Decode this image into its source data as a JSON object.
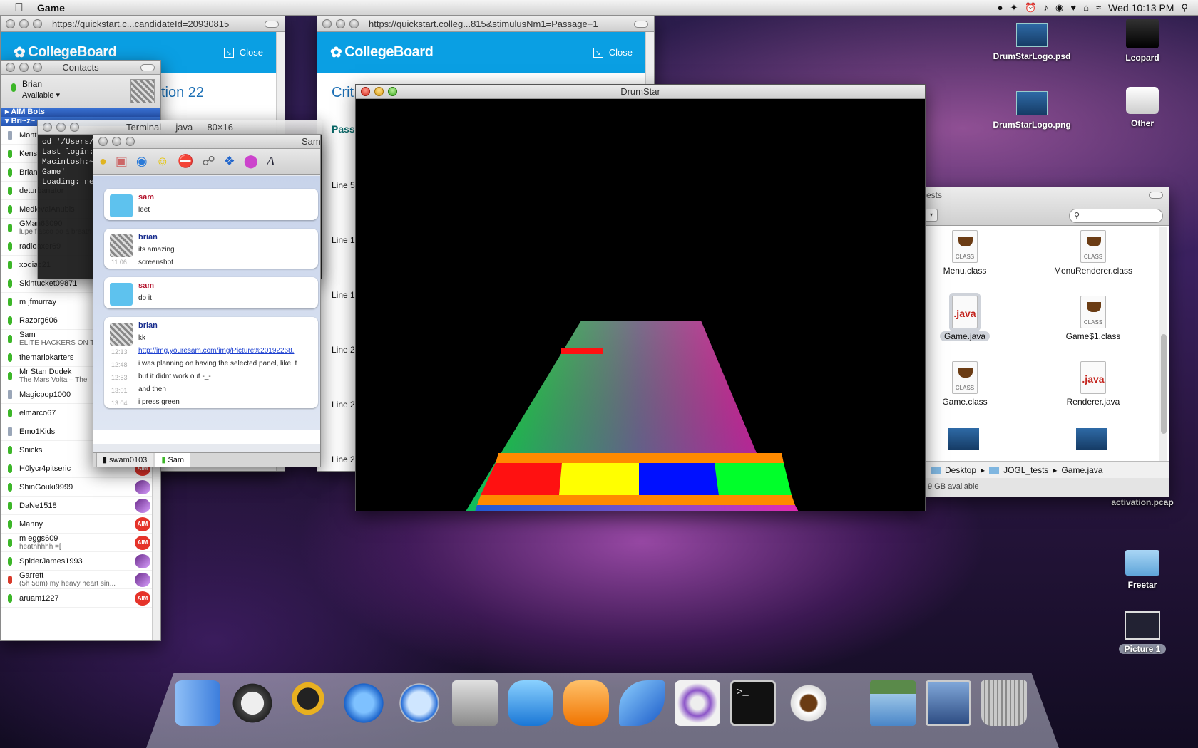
{
  "menubar": {
    "app_name": "Game",
    "clock": "Wed 10:13 PM"
  },
  "cb_window1": {
    "url": "https://quickstart.c...candidateId=20930815",
    "logo": "CollegeBoard",
    "close_label": "Close",
    "heading_fragment": "tion 22"
  },
  "cb_window2": {
    "url": "https://quickstart.colleg...815&stimulusNm1=Passage+1",
    "logo": "CollegeBoard",
    "close_label": "Close",
    "heading_fragment": "Crit",
    "subheading_fragment": "Pass",
    "lines": [
      "Line 5",
      "Line 1",
      "Line 1",
      "Line 2",
      "Line 2",
      "Line 2"
    ]
  },
  "contacts": {
    "title": "Contacts",
    "user_name": "Brian",
    "status": "Available",
    "group1": "AIM Bots",
    "group2": "Bri~z~",
    "items": [
      {
        "name": "Mont",
        "sub": "",
        "badge": ""
      },
      {
        "name": "Kens",
        "sub": "",
        "badge": ""
      },
      {
        "name": "Brian",
        "sub": "",
        "badge": ""
      },
      {
        "name": "deturbanator",
        "sub": "",
        "badge": ""
      },
      {
        "name": "MedievalAnubis",
        "sub": "",
        "badge": ""
      },
      {
        "name": "GMan63090",
        "sub": "lupe fiasco oo a breath",
        "badge": ""
      },
      {
        "name": "radioaxer69",
        "sub": "",
        "badge": ""
      },
      {
        "name": "xodiac21",
        "sub": "",
        "badge": ""
      },
      {
        "name": "Skintucket09871",
        "sub": "",
        "badge": ""
      },
      {
        "name": "m    jfmurray",
        "sub": "",
        "badge": ""
      },
      {
        "name": "Razorg606",
        "sub": "",
        "badge": ""
      },
      {
        "name": "Sam",
        "sub": "ELITE HACKERS ON TH",
        "badge": ""
      },
      {
        "name": "themariokarters",
        "sub": "",
        "badge": ""
      },
      {
        "name": "Mr Stan Dudek",
        "sub": "The Mars Volta – The",
        "badge": ""
      },
      {
        "name": "Magicpop1000",
        "sub": "",
        "badge": ""
      },
      {
        "name": "elmarco67",
        "sub": "",
        "badge": ""
      },
      {
        "name": "Emo1Kids",
        "sub": "",
        "badge": ""
      },
      {
        "name": "Snicks",
        "sub": "",
        "badge": "AIM"
      },
      {
        "name": "H0lycr4pitseric",
        "sub": "",
        "badge": "AIM"
      },
      {
        "name": "ShinGouki9999",
        "sub": "",
        "badge": "img"
      },
      {
        "name": "DaNe1518",
        "sub": "",
        "badge": "img"
      },
      {
        "name": "Manny",
        "sub": "",
        "badge": "AIM"
      },
      {
        "name": "m eggs609",
        "sub": "heathhhhh =[",
        "badge": "AIM"
      },
      {
        "name": "SpiderJames1993",
        "sub": "",
        "badge": "img"
      },
      {
        "name": "Garrett",
        "sub": "(5h 58m) my heavy heart sin...",
        "badge": "img"
      },
      {
        "name": "aruam1227",
        "sub": "",
        "badge": "AIM"
      }
    ]
  },
  "terminal": {
    "title": "Terminal — java — 80×16",
    "lines": [
      "cd '/Users/h",
      "Last login:",
      "Macintosh:~",
      "Game'",
      "Loading: net"
    ]
  },
  "chat": {
    "title": "Sam",
    "messages": [
      {
        "sender": "sam",
        "lines": [
          "leet"
        ],
        "times": []
      },
      {
        "sender": "brian",
        "lines": [
          "its amazing",
          "screenshot"
        ],
        "times": [
          "",
          "11:06"
        ]
      },
      {
        "sender": "sam",
        "lines": [
          "do it"
        ],
        "times": []
      },
      {
        "sender": "brian",
        "lines": [
          "kk",
          "http://img.youresam.com/img/Picture%20192268.",
          "i was planning on having the selected panel, like, t",
          "but it didnt work out -_-",
          "and then",
          "i press green"
        ],
        "times": [
          "",
          "12:13",
          "12:48",
          "12:53",
          "13:01",
          "13:04"
        ]
      }
    ],
    "tabs": [
      "swam0103",
      "Sam"
    ]
  },
  "drumstar": {
    "title": "DrumStar"
  },
  "finder": {
    "title_fragment": "ests",
    "search_placeholder": "",
    "items": [
      {
        "name": "Menu.class",
        "kind": "class"
      },
      {
        "name": "MenuRenderer.class",
        "kind": "class"
      },
      {
        "name": "Game.java",
        "kind": "java"
      },
      {
        "name": "Game$1.class",
        "kind": "class"
      },
      {
        "name": "Game.class",
        "kind": "class"
      },
      {
        "name": "Renderer.java",
        "kind": "java"
      }
    ],
    "path": [
      "Desktop",
      "JOGL_tests",
      "Game.java"
    ],
    "status": "9 GB available"
  },
  "desktop_icons": [
    "DrumStarLogo.psd",
    "Leopard",
    "DrumStarLogo.png",
    "Other",
    "activation.pcap",
    "Freetar",
    "Picture 1"
  ],
  "dock": [
    "finder",
    "headphones",
    "adium",
    "safari",
    "clock",
    "installer",
    "word",
    "powerpoint",
    "mail",
    "xcode",
    "terminal",
    "coffee",
    "applications",
    "screen",
    "trash"
  ]
}
